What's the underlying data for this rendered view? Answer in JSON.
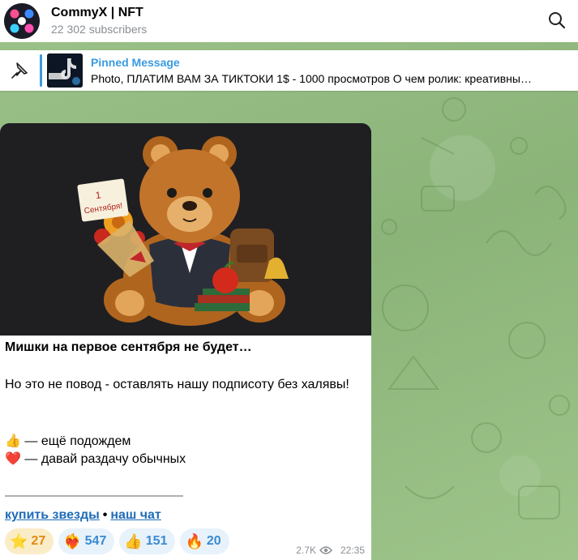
{
  "header": {
    "title": "CommyX | NFT",
    "subscribers": "22 302 subscribers"
  },
  "pinned": {
    "title": "Pinned Message",
    "text": "Photo, ПЛАТИМ ВАМ ЗА ТИКТОКИ 1$ - 1000 просмотров О чем ролик: креативны…"
  },
  "message": {
    "headline": "Мишки на первое сентября не будет…",
    "body": "Но это не повод - оставлять нашу подписоту без халявы!",
    "option1": "👍 — ещё подождем",
    "option2": "❤️ — давай раздачу обычных",
    "link_buy": "купить звезды",
    "link_sep": "•",
    "link_chat": "наш чат",
    "views": "2.7K",
    "time": "22:35"
  },
  "photo": {
    "sign_line1": "1",
    "sign_line2": "Сентября!"
  },
  "reactions": [
    {
      "emoji": "⭐",
      "count": "27"
    },
    {
      "emoji": "❤️‍🔥",
      "count": "547"
    },
    {
      "emoji": "👍",
      "count": "151"
    },
    {
      "emoji": "🔥",
      "count": "20"
    }
  ],
  "colors": {
    "accent": "#3a9ae0",
    "background": "#8fb87d",
    "photo_bg": "#1f1f22"
  }
}
